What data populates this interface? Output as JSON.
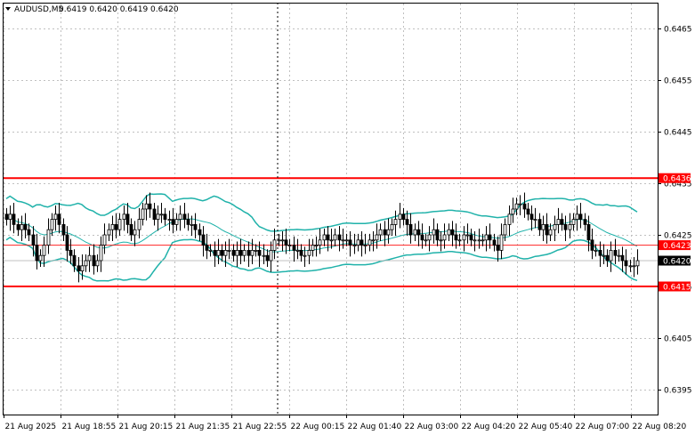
{
  "header": {
    "symbol_label": "AUDUSD,M5",
    "ohlc_label": "0.6419 0.6420 0.6419 0.6420",
    "menu_icon": "triangle-down-icon"
  },
  "colors": {
    "background": "#ffffff",
    "grid": "#c0c0c0",
    "candle": "#000000",
    "bollinger": "#20b2aa",
    "level_line": "#ff0000",
    "bid_line": "#c0c0c0",
    "price_tag_bg": "#ff0000",
    "current_tag_bg": "#000000"
  },
  "chart_data": {
    "type": "candlestick",
    "instrument": "AUDUSD",
    "timeframe": "M5",
    "y_ticks": [
      "0.6465",
      "0.6455",
      "0.6445",
      "0.6435",
      "0.6425",
      "0.6415",
      "0.6405",
      "0.6395"
    ],
    "x_ticks": [
      "21 Aug 2025",
      "21 Aug 18:55",
      "21 Aug 20:15",
      "21 Aug 21:35",
      "21 Aug 22:55",
      "22 Aug 00:15",
      "22 Aug 01:40",
      "22 Aug 03:00",
      "22 Aug 04:20",
      "22 Aug 05:40",
      "22 Aug 07:00",
      "22 Aug 08:20"
    ],
    "ylim": [
      0.6391,
      0.6476
    ],
    "grid": true,
    "levels": [
      {
        "value": 0.6436,
        "label": "0.6436",
        "color": "#ff0000"
      },
      {
        "value": 0.6415,
        "label": "0.6415",
        "color": "#ff0000"
      },
      {
        "value": 0.6423,
        "label": "0.6423",
        "color": "#ff0000"
      }
    ],
    "current_price": {
      "value": 0.642,
      "label": "0.6420"
    },
    "closes": [
      0.6428,
      0.6429,
      0.6427,
      0.6426,
      0.6427,
      0.6426,
      0.6425,
      0.6423,
      0.642,
      0.6421,
      0.6423,
      0.6426,
      0.6428,
      0.6429,
      0.6427,
      0.6425,
      0.6422,
      0.6421,
      0.6419,
      0.6418,
      0.6419,
      0.642,
      0.6421,
      0.6419,
      0.642,
      0.6423,
      0.6425,
      0.6426,
      0.6427,
      0.6426,
      0.6428,
      0.6429,
      0.6427,
      0.6425,
      0.6426,
      0.6428,
      0.643,
      0.6431,
      0.643,
      0.6428,
      0.6429,
      0.6429,
      0.6428,
      0.6428,
      0.6427,
      0.6428,
      0.6429,
      0.6428,
      0.6427,
      0.6427,
      0.6426,
      0.6425,
      0.6423,
      0.6422,
      0.6422,
      0.6421,
      0.6422,
      0.6421,
      0.6422,
      0.6422,
      0.6421,
      0.6422,
      0.6421,
      0.6422,
      0.6421,
      0.6422,
      0.6422,
      0.6421,
      0.6421,
      0.642,
      0.6422,
      0.6424,
      0.6424,
      0.6424,
      0.6423,
      0.6423,
      0.6422,
      0.6422,
      0.6421,
      0.6421,
      0.6422,
      0.6423,
      0.6423,
      0.6424,
      0.6425,
      0.6424,
      0.6424,
      0.6425,
      0.6424,
      0.6424,
      0.6424,
      0.6423,
      0.6423,
      0.6424,
      0.6423,
      0.6423,
      0.6424,
      0.6424,
      0.6425,
      0.6426,
      0.6425,
      0.6426,
      0.6427,
      0.6428,
      0.6429,
      0.6428,
      0.6427,
      0.6425,
      0.6426,
      0.6425,
      0.6424,
      0.6424,
      0.6425,
      0.6426,
      0.6424,
      0.6424,
      0.6425,
      0.6426,
      0.6425,
      0.6424,
      0.6424,
      0.6425,
      0.6425,
      0.6424,
      0.6424,
      0.6424,
      0.6424,
      0.6425,
      0.6424,
      0.6423,
      0.6422,
      0.6425,
      0.6427,
      0.6429,
      0.643,
      0.6431,
      0.6431,
      0.643,
      0.6429,
      0.6428,
      0.6428,
      0.6426,
      0.6427,
      0.6425,
      0.6426,
      0.6427,
      0.6428,
      0.6427,
      0.6426,
      0.6427,
      0.6428,
      0.6429,
      0.6428,
      0.6427,
      0.6424,
      0.6422,
      0.6422,
      0.6421,
      0.6421,
      0.642,
      0.6422,
      0.6421,
      0.6421,
      0.642,
      0.6419,
      0.6419,
      0.6419,
      0.642
    ]
  }
}
